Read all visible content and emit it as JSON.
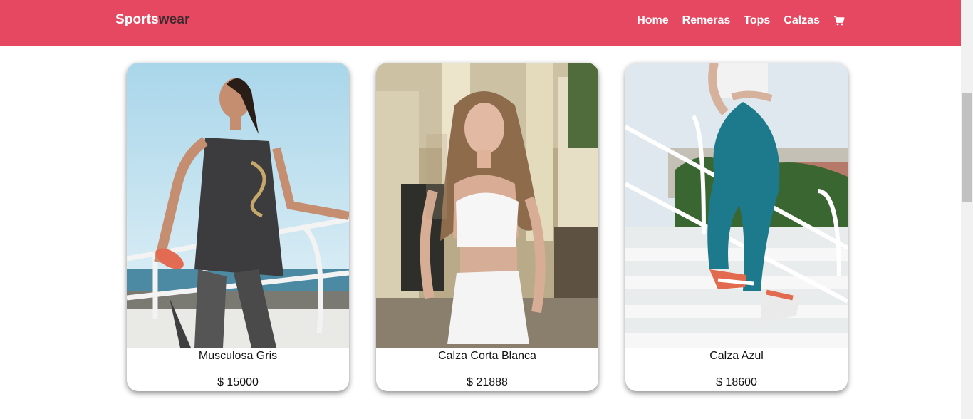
{
  "navbar": {
    "brand_part1": "Sports",
    "brand_part2": "wear",
    "links": [
      {
        "label": "Home"
      },
      {
        "label": "Remeras"
      },
      {
        "label": "Tops"
      },
      {
        "label": "Calzas"
      }
    ],
    "cart_icon": "shopping-cart-icon"
  },
  "products": [
    {
      "name": "Musculosa Gris",
      "price": "$ 15000"
    },
    {
      "name": "Calza Corta Blanca",
      "price": "$ 21888"
    },
    {
      "name": "Calza Azul",
      "price": "$ 18600"
    }
  ],
  "colors": {
    "navbar_bg": "#e64862",
    "brand_accent": "#3d2a2e"
  }
}
